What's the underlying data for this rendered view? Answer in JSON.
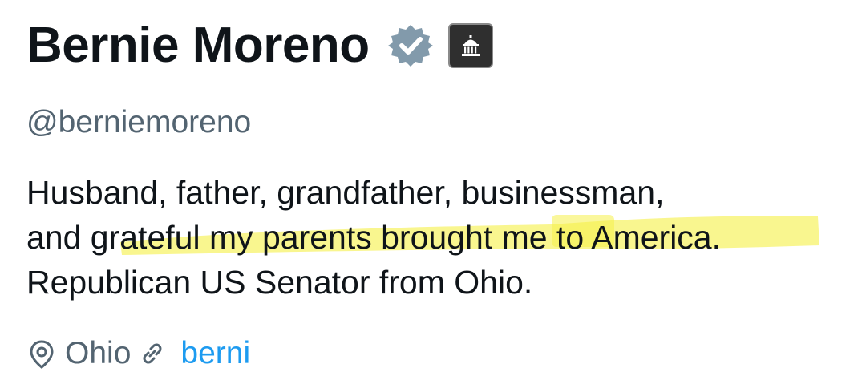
{
  "profile": {
    "display_name": "Bernie Moreno",
    "handle": "@berniemoreno",
    "verified_badge_icon": "verified-badge-icon",
    "verified_badge_color": "#829aab",
    "affiliate_badge_icon": "government-building-icon",
    "bio_lines": [
      "Husband, father, grandfather, businessman,",
      "and grateful my parents brought me to America.",
      "Republican US Senator from Ohio."
    ],
    "highlight_color": "#f5f04a",
    "location": "Ohio",
    "website": "berni"
  }
}
